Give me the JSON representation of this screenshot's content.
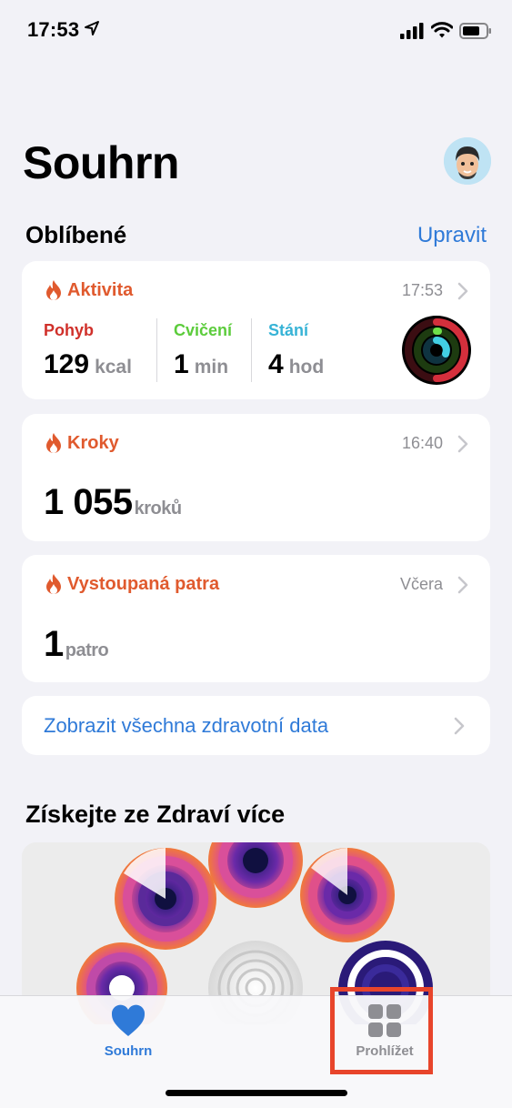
{
  "status": {
    "time": "17:53"
  },
  "header": {
    "title": "Souhrn"
  },
  "favorites": {
    "title": "Oblíbené",
    "edit_label": "Upravit"
  },
  "activity": {
    "title": "Aktivita",
    "time": "17:53",
    "move": {
      "label": "Pohyb",
      "value": "129",
      "unit": "kcal",
      "color": "#d0302a"
    },
    "exercise": {
      "label": "Cvičení",
      "value": "1",
      "unit": "min",
      "color": "#5ccc3c"
    },
    "stand": {
      "label": "Stání",
      "value": "4",
      "unit": "hod",
      "color": "#37b3d6"
    }
  },
  "steps": {
    "title": "Kroky",
    "time": "16:40",
    "value": "1 055",
    "unit": "kroků"
  },
  "floors": {
    "title": "Vystoupaná patra",
    "time": "Včera",
    "value": "1",
    "unit": "patro"
  },
  "all_data_link": "Zobrazit všechna zdravotní data",
  "promo": {
    "title": "Získejte ze Zdraví více"
  },
  "tabs": {
    "summary": {
      "label": "Souhrn",
      "icon": "heart-icon"
    },
    "browse": {
      "label": "Prohlížet",
      "icon": "grid-icon"
    }
  },
  "colors": {
    "accent": "#2f7ad8",
    "orange": "#e05a2e",
    "highlight": "#e8452b"
  }
}
